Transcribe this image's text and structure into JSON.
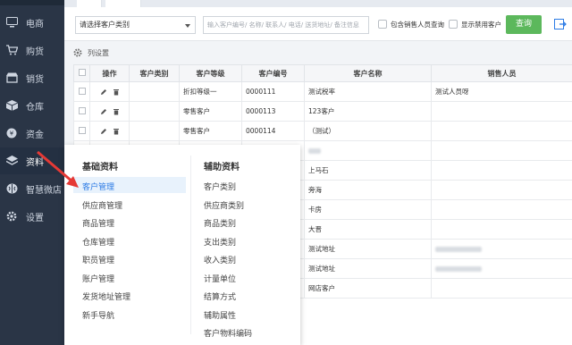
{
  "sidebar": {
    "items": [
      {
        "label": "电商",
        "icon": "monitor-icon"
      },
      {
        "label": "购货",
        "icon": "cart-icon"
      },
      {
        "label": "销货",
        "icon": "shop-icon"
      },
      {
        "label": "仓库",
        "icon": "box-icon"
      },
      {
        "label": "资金",
        "icon": "coin-icon"
      },
      {
        "label": "资料",
        "icon": "layers-icon"
      },
      {
        "label": "智慧微店",
        "icon": "brain-icon"
      },
      {
        "label": "设置",
        "icon": "gear-icon"
      }
    ]
  },
  "filters": {
    "category_select": "请选择客户类别",
    "search_placeholder": "输入客户编号/ 名称/ 联系人/ 电话/ 送货地址/ 备注信息",
    "include_sales_label": "包含销售人员查询",
    "show_disabled_label": "显示禁用客户",
    "query_button": "查询"
  },
  "column_settings": "列设置",
  "table": {
    "headers": [
      "操作",
      "客户类别",
      "客户等级",
      "客户编号",
      "客户名称",
      "销售人员"
    ],
    "rows": [
      {
        "level": "折扣等级一",
        "code": "0000111",
        "name": "测试税率",
        "sales": "测试人员呀"
      },
      {
        "level": "零售客户",
        "code": "0000113",
        "name": "123客户",
        "sales": ""
      },
      {
        "level": "零售客户",
        "code": "0000114",
        "name": "（测试）",
        "sales": ""
      },
      {
        "level": "",
        "code": "",
        "name": "",
        "sales": ""
      },
      {
        "level": "",
        "code": "",
        "name": "上马石",
        "sales": ""
      },
      {
        "level": "",
        "code": "",
        "name": "旁海",
        "sales": ""
      },
      {
        "level": "",
        "code": "",
        "name": "卡房",
        "sales": ""
      },
      {
        "level": "",
        "code": "",
        "name": "大晋",
        "sales": ""
      },
      {
        "level": "",
        "code": "",
        "name": "测试地址",
        "sales": ""
      },
      {
        "level": "",
        "code": "",
        "name": "测试地址",
        "sales": ""
      },
      {
        "level": "",
        "code": "",
        "name": "网店客户",
        "sales": ""
      }
    ]
  },
  "flyout": {
    "basic_title": "基础资料",
    "basic_items": [
      "客户管理",
      "供应商管理",
      "商品管理",
      "仓库管理",
      "职员管理",
      "账户管理",
      "发货地址管理",
      "新手导航"
    ],
    "aux_title": "辅助资料",
    "aux_items": [
      "客户类别",
      "供应商类别",
      "商品类别",
      "支出类别",
      "收入类别",
      "计量单位",
      "结算方式",
      "辅助属性",
      "客户物料编码"
    ]
  },
  "colors": {
    "sidebar_bg": "#2a3546",
    "query_button": "#5cb85c",
    "active_link": "#2c7be5",
    "arrow": "#e53935"
  }
}
